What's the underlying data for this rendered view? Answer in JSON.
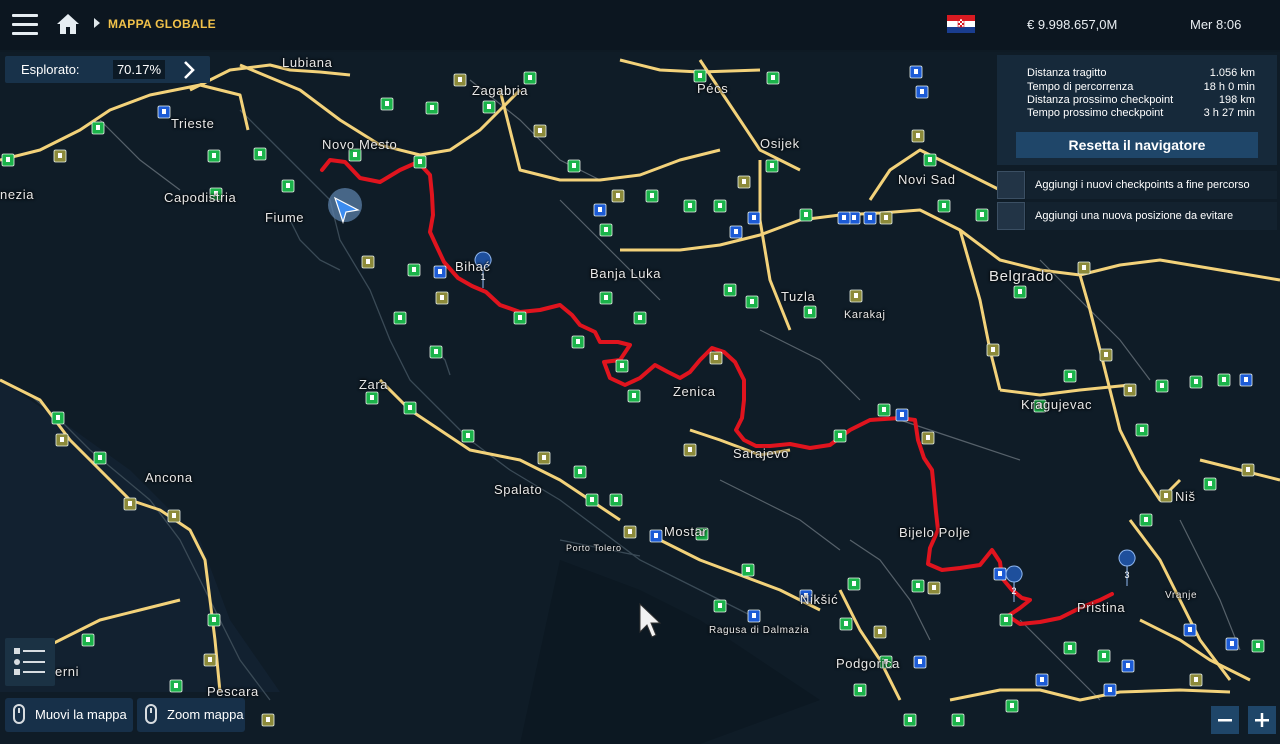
{
  "header": {
    "breadcrumb": "MAPPA GLOBALE",
    "money": "€ 9.998.657,0M",
    "clock": "Mer 8:06",
    "flag": "croatia-flag"
  },
  "explored": {
    "label": "Esplorato:",
    "value": "70.17%"
  },
  "route_info": {
    "rows": [
      {
        "label": "Distanza tragitto",
        "value": "1.056 km"
      },
      {
        "label": "Tempo di percorrenza",
        "value": "18 h 0 min"
      },
      {
        "label": "Distanza prossimo checkpoint",
        "value": "198 km"
      },
      {
        "label": "Tempo prossimo checkpoint",
        "value": "3 h 27 min"
      }
    ],
    "reset_button": "Resetta il navigatore",
    "options": [
      "Aggiungi i nuovi checkpoints a fine percorso",
      "Aggiungi una nuova posizione da evitare"
    ]
  },
  "cities": [
    "Lubiana",
    "Zagabria",
    "Pécs",
    "Trieste",
    "Novo Mesto",
    "Osijek",
    "Capodistria",
    "Fiume",
    "Novi Sad",
    "Bihać",
    "Banja Luka",
    "Belgrado",
    "Tuzla",
    "Karakaj",
    "Zara",
    "Zenica",
    "Kragujevac",
    "Sarajevo",
    "Ancona",
    "Spalato",
    "Niš",
    "Mostar",
    "Bijelo Polje",
    "Porto Tolero",
    "Nikšić",
    "Pristina",
    "Ragusa di Dalmazia",
    "Vranje",
    "Podgorica",
    "Pescara",
    "nezia",
    "erni"
  ],
  "checkpoints": [
    "1",
    "2",
    "3"
  ],
  "controls": {
    "move_hint": "Muovi la mappa",
    "zoom_hint": "Zoom mappa"
  },
  "colors": {
    "route": "#e0141e",
    "highway": "#f3d27a",
    "panel": "#16293a",
    "accent_button": "#1f4669",
    "crumb": "#f2c24a"
  }
}
